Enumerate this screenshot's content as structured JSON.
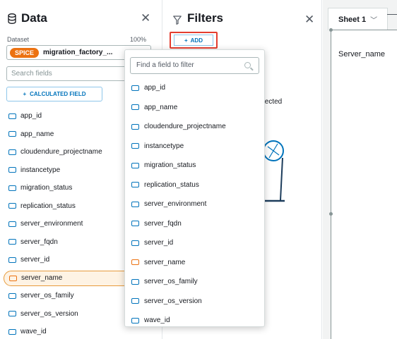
{
  "data_panel": {
    "title": "Data",
    "dataset_label": "Dataset",
    "dataset_percent": "100%",
    "spice_badge": "SPICE",
    "dataset_name": "migration_factory_...",
    "search_placeholder": "Search fields",
    "calculated_field_label": "CALCULATED FIELD",
    "fields": [
      {
        "label": "app_id",
        "icon": "dimension-icon"
      },
      {
        "label": "app_name",
        "icon": "dimension-icon"
      },
      {
        "label": "cloudendure_projectname",
        "icon": "dimension-icon"
      },
      {
        "label": "instancetype",
        "icon": "dimension-icon"
      },
      {
        "label": "migration_status",
        "icon": "dimension-icon"
      },
      {
        "label": "replication_status",
        "icon": "dimension-icon"
      },
      {
        "label": "server_environment",
        "icon": "dimension-icon"
      },
      {
        "label": "server_fqdn",
        "icon": "dimension-icon"
      },
      {
        "label": "server_id",
        "icon": "dimension-icon"
      },
      {
        "label": "server_name",
        "icon": "dimension-icon",
        "selected": true
      },
      {
        "label": "server_os_family",
        "icon": "dimension-icon"
      },
      {
        "label": "server_os_version",
        "icon": "dimension-icon"
      },
      {
        "label": "wave_id",
        "icon": "dimension-icon"
      }
    ]
  },
  "filters_panel": {
    "title": "Filters",
    "add_label": "ADD",
    "status_text": "elected"
  },
  "filter_dropdown": {
    "search_placeholder": "Find a field to filter",
    "items": [
      "app_id",
      "app_name",
      "cloudendure_projectname",
      "instancetype",
      "migration_status",
      "replication_status",
      "server_environment",
      "server_fqdn",
      "server_id",
      "server_name",
      "server_os_family",
      "server_os_version",
      "wave_id"
    ],
    "highlighted_item": "server_name"
  },
  "sheet": {
    "tab_label": "Sheet 1",
    "visual_text": "Server_name"
  },
  "colors": {
    "accent": "#0073bb",
    "spice": "#ec7211",
    "highlight_border": "#e43d2f"
  }
}
